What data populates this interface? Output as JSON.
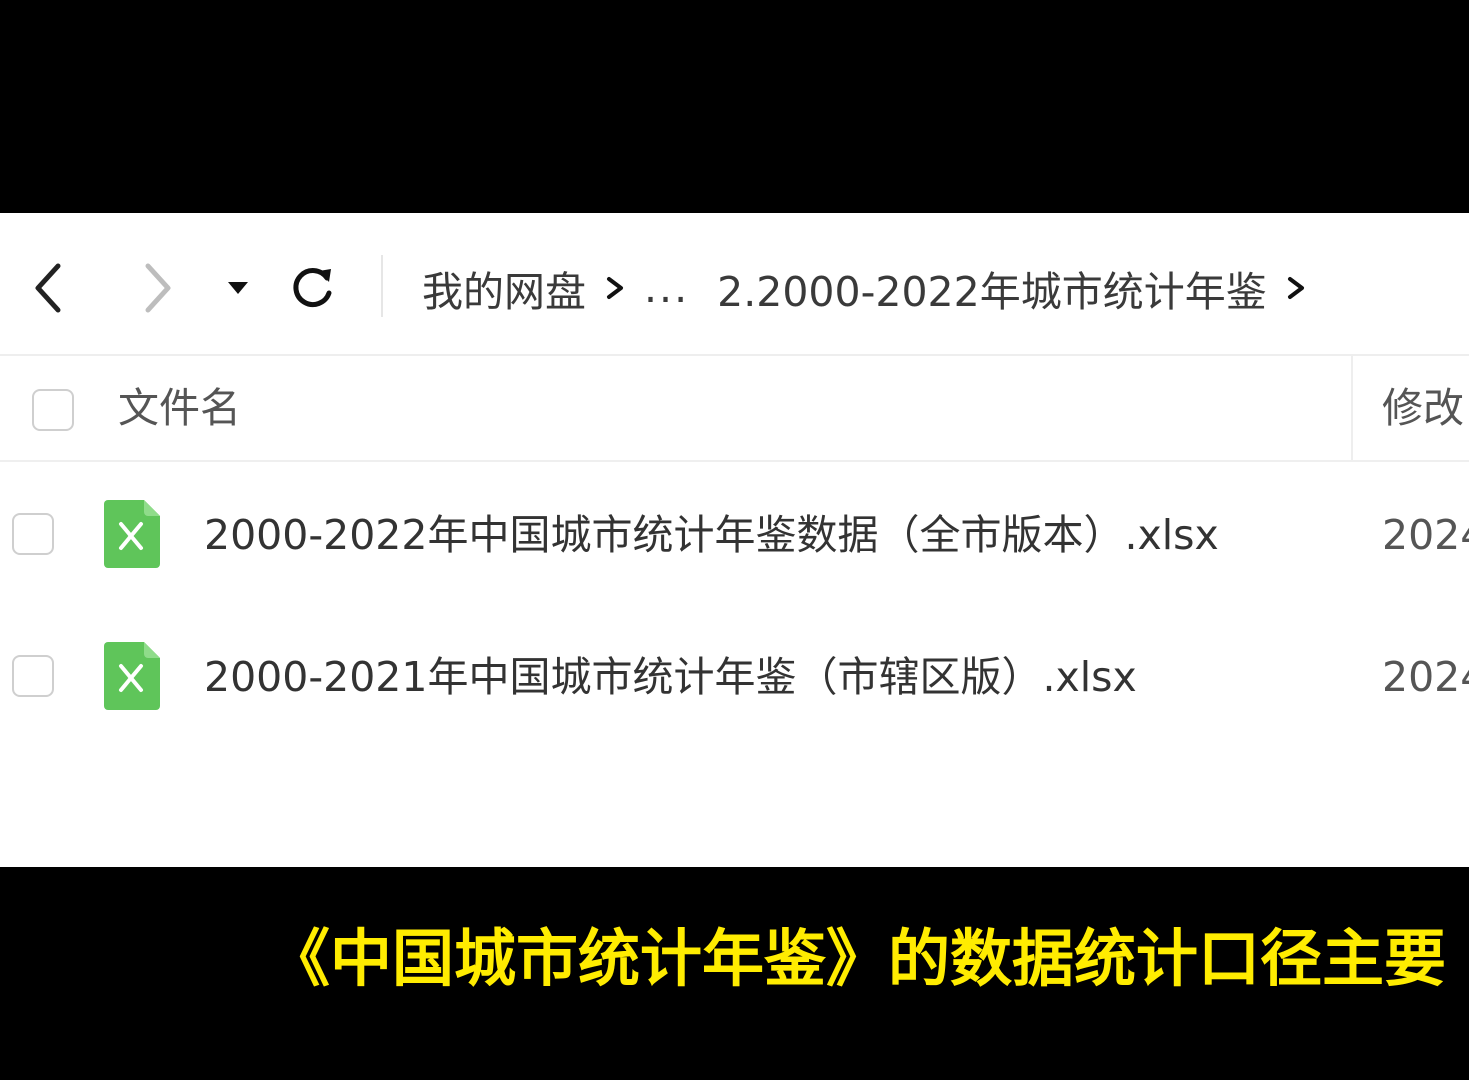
{
  "toolbar": {
    "breadcrumb": {
      "root": "我的网盘",
      "ellipsis": "...",
      "current": "2.2000-2022年城市统计年鉴"
    }
  },
  "table": {
    "columns": {
      "name": "文件名",
      "modified": "修改"
    },
    "rows": [
      {
        "name": "2000-2022年中国城市统计年鉴数据（全市版本）.xlsx",
        "date": "2024",
        "icon": "excel-file-icon"
      },
      {
        "name": "2000-2021年中国城市统计年鉴（市辖区版）.xlsx",
        "date": "2024",
        "icon": "excel-file-icon"
      }
    ]
  },
  "subtitle": "《中国城市统计年鉴》的数据统计口径主要",
  "colors": {
    "excel_green": "#5fc55a",
    "subtitle_yellow": "#ffec00"
  }
}
